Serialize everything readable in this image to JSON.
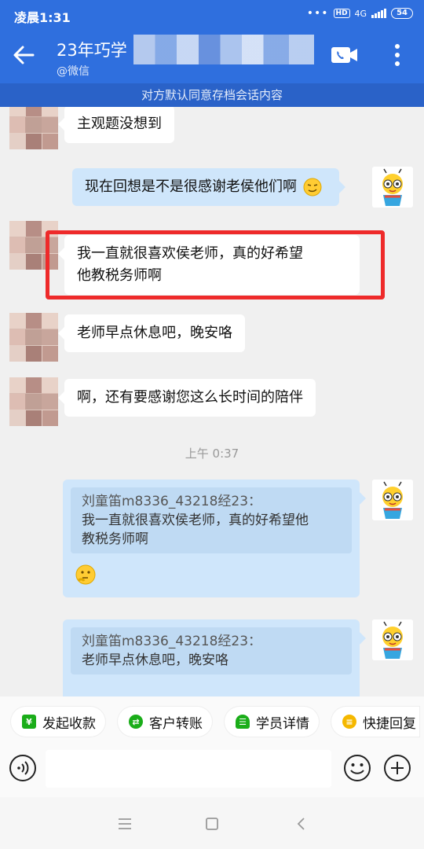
{
  "status_bar": {
    "time": "凌晨1:31",
    "hd": "HD",
    "network": "4G",
    "battery": "54"
  },
  "header": {
    "title": "23年巧学",
    "subtitle": "@微信"
  },
  "notice": "对方默认同意存档会话内容",
  "messages": [
    {
      "side": "in",
      "text": "主观题没想到"
    },
    {
      "side": "out",
      "text": "现在回想是不是很感谢老侯他们啊"
    },
    {
      "side": "in",
      "line1": "我一直就很喜欢侯老师，真的好希望",
      "line2": "他教税务师啊"
    },
    {
      "side": "in",
      "text": "老师早点休息吧，晚安咯"
    },
    {
      "side": "in",
      "text": "啊，还有要感谢您这么长时间的陪伴"
    }
  ],
  "timestamp": "上午 0:37",
  "quoted_replies": [
    {
      "quote_author": "刘童笛m8336_43218经23：",
      "quote_line1": "我一直就很喜欢侯老师，真的好希望他",
      "quote_line2": "教税务师啊",
      "reply_icon": "thinking-face-icon"
    },
    {
      "quote_author": "刘童笛m8336_43218经23：",
      "quote_line1": "老师早点休息吧，晚安咯"
    }
  ],
  "quick_actions": [
    {
      "label": "发起收款",
      "icon": "yuan-icon",
      "color": "#1aad19"
    },
    {
      "label": "客户转账",
      "icon": "transfer-icon",
      "color": "#1aad19"
    },
    {
      "label": "学员详情",
      "icon": "user-card-icon",
      "color": "#1aad19"
    },
    {
      "label": "快捷回复",
      "icon": "quick-reply-icon",
      "color": "#f5b800"
    }
  ],
  "input": {
    "placeholder": ""
  },
  "colors": {
    "header": "#2f6fde",
    "bubble_out": "#cfe6fb",
    "highlight": "#ee2a2a"
  }
}
